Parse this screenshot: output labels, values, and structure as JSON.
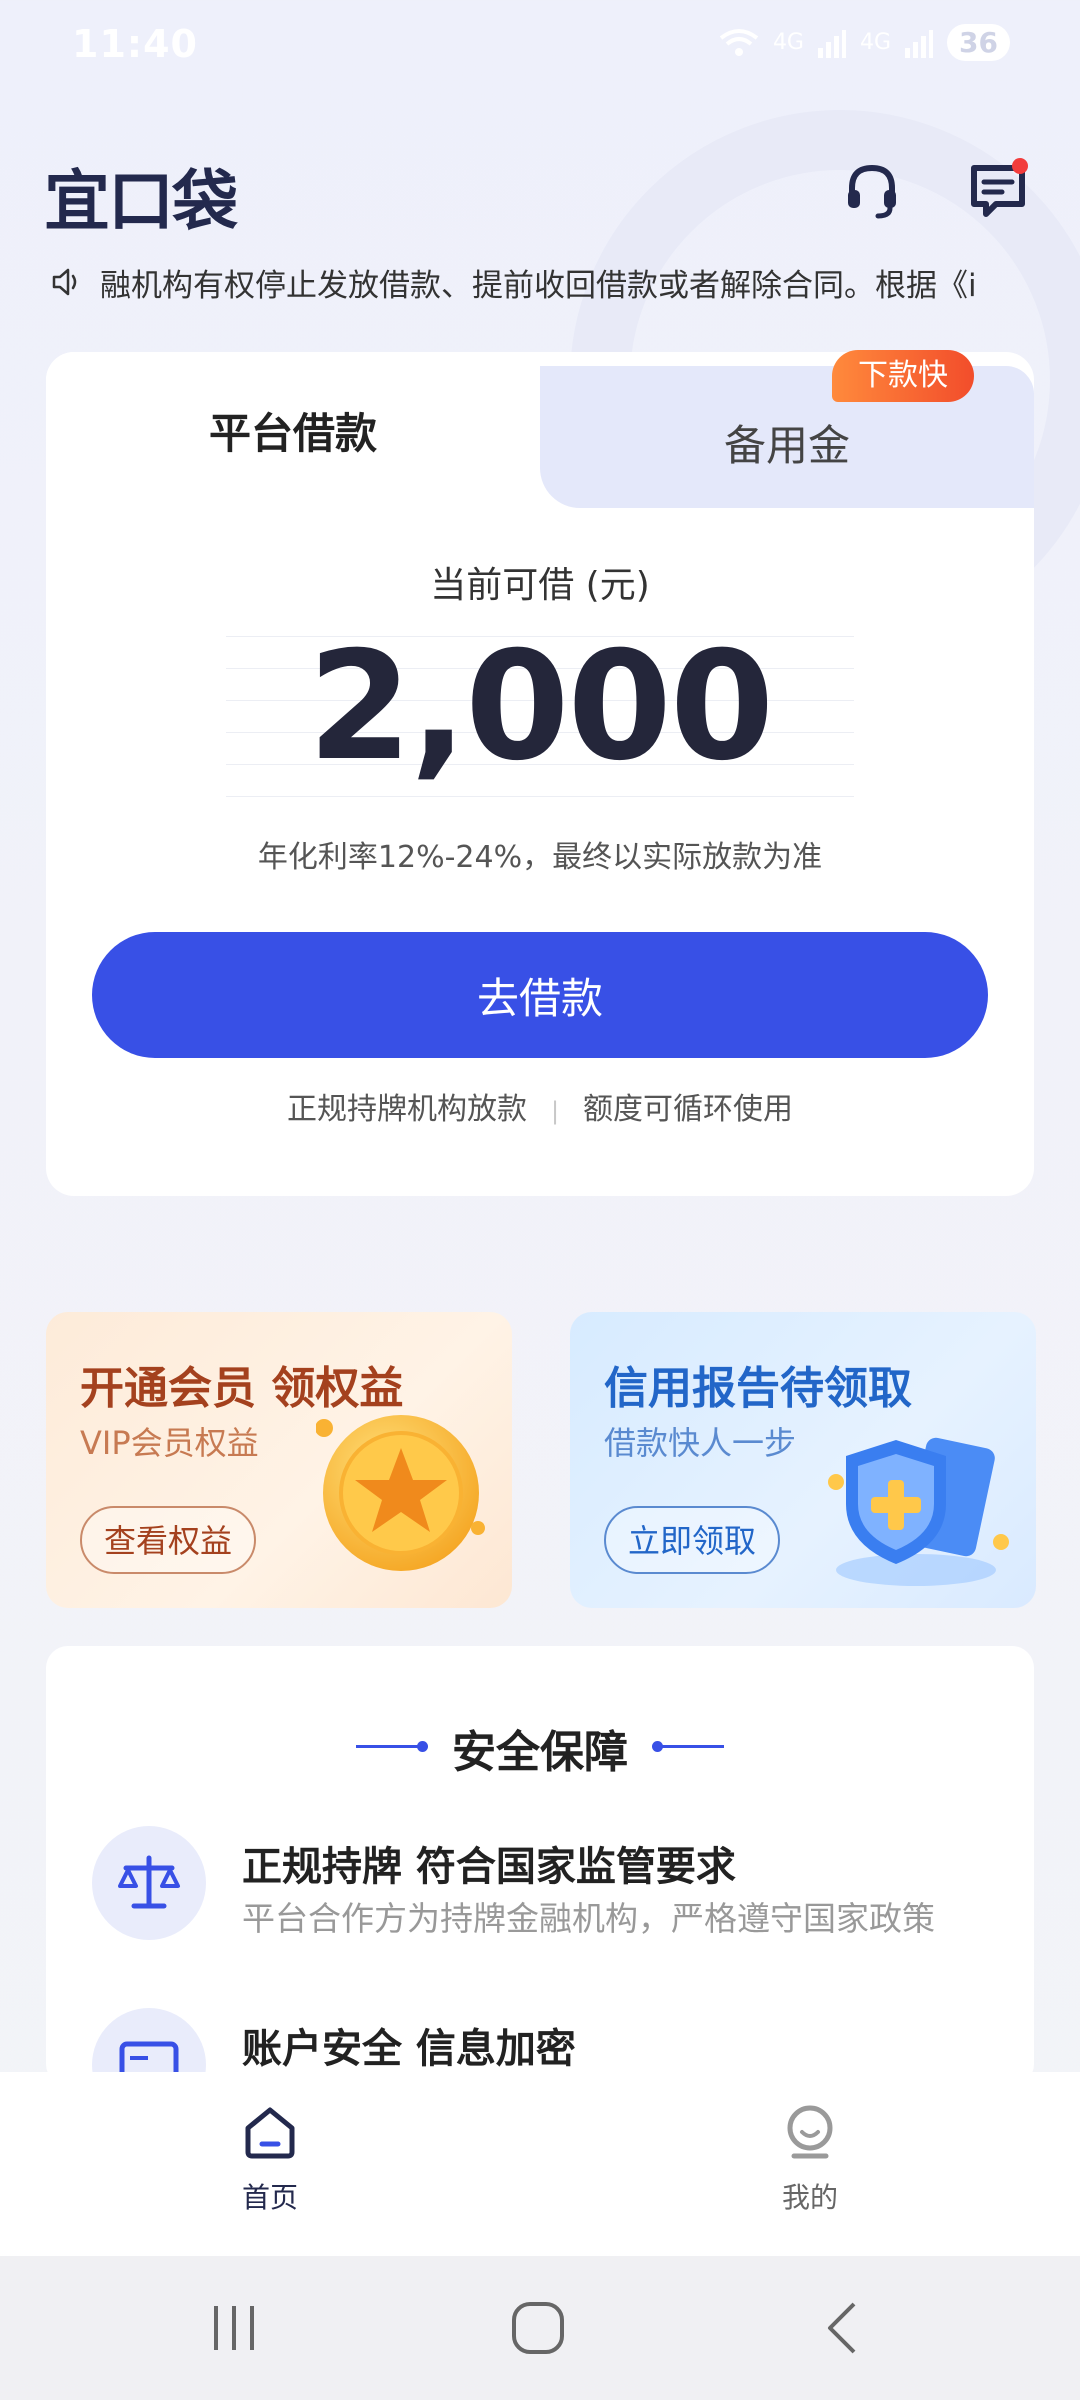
{
  "status_bar": {
    "time": "11:40",
    "signal_labels": [
      "4G",
      "4G"
    ],
    "battery": "36"
  },
  "header": {
    "logo": "宜口袋",
    "support_icon": "headset-icon",
    "message_icon": "message-icon"
  },
  "notice": {
    "text": "融机构有权停止发放借款、提前收回借款或者解除合同。根据《i"
  },
  "loan_card": {
    "tab_main": "平台借款",
    "tab_alt": "备用金",
    "tab_alt_badge": "下款快",
    "available_label": "当前可借 (元)",
    "amount": "2,000",
    "rate_text": "年化利率12%-24%，最终以实际放款为准",
    "borrow_button": "去借款",
    "feature_1": "正规持牌机构放款",
    "feature_sep": "|",
    "feature_2": "额度可循环使用"
  },
  "promos": [
    {
      "title": "开通会员 领权益",
      "subtitle": "VIP会员权益",
      "button": "查看权益"
    },
    {
      "title": "信用报告待领取",
      "subtitle": "借款快人一步",
      "button": "立即领取"
    }
  ],
  "security": {
    "title": "安全保障",
    "items": [
      {
        "title": "正规持牌 符合国家监管要求",
        "desc": "平台合作方为持牌金融机构，严格遵守国家政策",
        "icon": "scale-icon"
      },
      {
        "title": "账户安全 信息加密",
        "icon": "id-card-icon"
      }
    ]
  },
  "bottom_nav": [
    {
      "label": "首页",
      "icon": "home-icon",
      "active": true
    },
    {
      "label": "我的",
      "icon": "profile-icon",
      "active": false
    }
  ],
  "colors": {
    "primary": "#3850e6",
    "badge": "#f24d2b",
    "logo": "#23294d"
  }
}
